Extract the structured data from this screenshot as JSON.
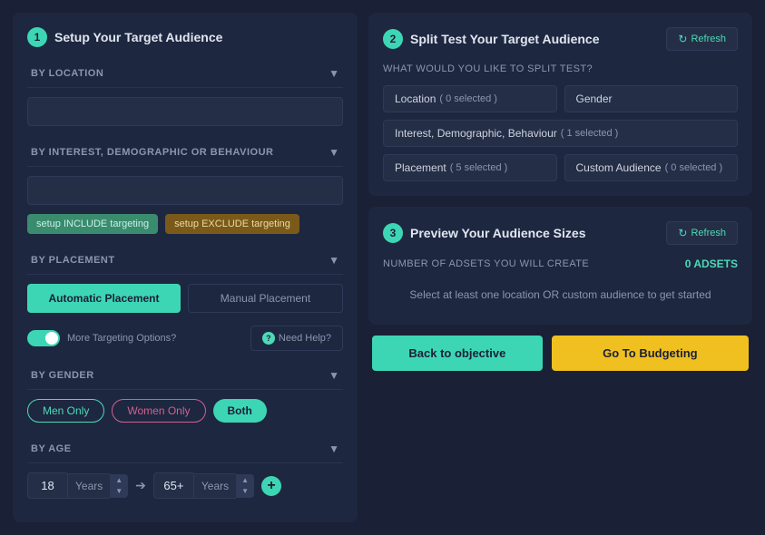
{
  "left_panel": {
    "step": "1",
    "title": "Setup Your Target Audience",
    "by_location": {
      "label": "BY LOCATION",
      "placeholder": ""
    },
    "by_interest": {
      "label": "BY INTEREST, DEMOGRAPHIC OR BEHAVIOUR",
      "placeholder": "",
      "include_btn": "setup INCLUDE targeting",
      "exclude_btn": "setup EXCLUDE targeting"
    },
    "by_placement": {
      "label": "BY PLACEMENT",
      "auto_label": "Automatic Placement",
      "manual_label": "Manual Placement"
    },
    "more_targeting": {
      "label": "More Targeting Options?"
    },
    "need_help": {
      "label": "Need Help?"
    },
    "by_gender": {
      "label": "BY GENDER",
      "men_label": "Men Only",
      "women_label": "Women Only",
      "both_label": "Both"
    },
    "by_age": {
      "label": "BY AGE",
      "min_value": "18",
      "min_unit": "Years",
      "max_value": "65+",
      "max_unit": "Years"
    }
  },
  "split_test": {
    "step": "2",
    "title": "Split Test Your Target Audience",
    "refresh_label": "Refresh",
    "question": "WHAT WOULD YOU LIKE TO SPLIT TEST?",
    "chips": [
      {
        "label": "Location",
        "count": "( 0 selected )"
      },
      {
        "label": "Gender",
        "count": ""
      },
      {
        "label": "Interest, Demographic, Behaviour",
        "count": "( 1 selected )"
      },
      {
        "label": "Placement",
        "count": "( 5 selected )"
      },
      {
        "label": "Custom Audience",
        "count": "( 0 selected )"
      }
    ]
  },
  "preview": {
    "step": "3",
    "title": "Preview Your Audience Sizes",
    "refresh_label": "Refresh",
    "adsets_label": "NUMBER OF ADSETS YOU WILL CREATE",
    "adsets_count": "0 ADSETS",
    "message": "Select at least one location OR custom audience to get started"
  },
  "footer": {
    "back_label": "Back to objective",
    "budgeting_label": "Go To Budgeting"
  }
}
